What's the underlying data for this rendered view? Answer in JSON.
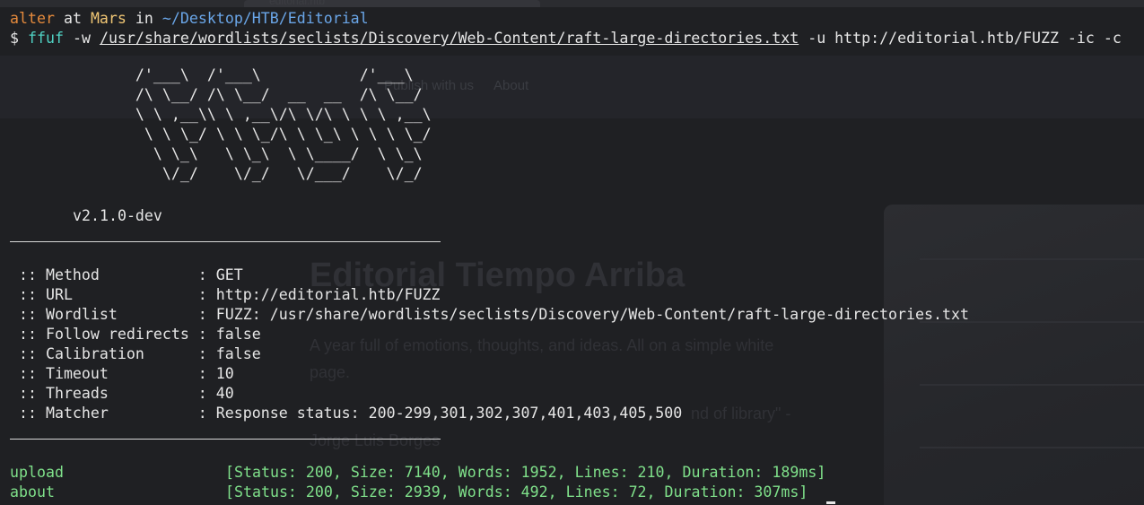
{
  "prompt": {
    "user": "alter",
    "at": "at",
    "host": "Mars",
    "in": "in",
    "cwd": "~/Desktop/HTB/Editorial",
    "symbol": "$"
  },
  "command": {
    "program": "ffuf",
    "flag_w": "-w",
    "wordlist_path": "/usr/share/wordlists/seclists/Discovery/Web-Content/raft-large-directories.txt",
    "rest": "-u http://editorial.htb/FUZZ -ic -c"
  },
  "banner": {
    "ascii_art": "       /'___\\  /'___\\           /'___\\       \n       /\\ \\__/ /\\ \\__/  __  __  /\\ \\__/       \n       \\ \\ ,__\\\\ \\ ,__\\/\\ \\/\\ \\ \\ \\ ,__\\      \n        \\ \\ \\_/ \\ \\ \\_/\\ \\ \\_\\ \\ \\ \\ \\_/      \n         \\ \\_\\   \\ \\_\\  \\ \\____/  \\ \\_\\       \n          \\/_/    \\/_/   \\/___/    \\/_/       ",
    "version": "v2.1.0-dev"
  },
  "config": [
    {
      "key": " :: Method           ",
      "value": ": GET"
    },
    {
      "key": " :: URL              ",
      "value": ": http://editorial.htb/FUZZ"
    },
    {
      "key": " :: Wordlist         ",
      "value": ": FUZZ: /usr/share/wordlists/seclists/Discovery/Web-Content/raft-large-directories.txt"
    },
    {
      "key": " :: Follow redirects ",
      "value": ": false"
    },
    {
      "key": " :: Calibration      ",
      "value": ": false"
    },
    {
      "key": " :: Timeout          ",
      "value": ": 10"
    },
    {
      "key": " :: Threads          ",
      "value": ": 40"
    },
    {
      "key": " :: Matcher          ",
      "value": ": Response status: 200-299,301,302,307,401,403,405,500"
    }
  ],
  "results": [
    {
      "path": "upload",
      "info": "[Status: 200, Size: 7140, Words: 1952, Lines: 210, Duration: 189ms]"
    },
    {
      "path": "about",
      "info": "[Status: 200, Size: 2939, Words: 492, Lines: 72, Duration: 307ms]"
    }
  ],
  "background_page": {
    "tab_title": "editorial.htb",
    "nav_publish": "Publish with us",
    "nav_about": "About",
    "heading": "Editorial Tiempo Arriba",
    "tagline_1": "A year full of emotions, thoughts, and ideas. All on a simple white",
    "tagline_2": "page.",
    "quote_fragment": "nd of library\" -",
    "quote_author": "Jorge Luis Borges"
  },
  "colors": {
    "terminal_bg": "#1f2023",
    "user": "#e58a3c",
    "host": "#f0c674",
    "path": "#6aa6e8",
    "command": "#4fd0c2",
    "result": "#7fe08a"
  }
}
